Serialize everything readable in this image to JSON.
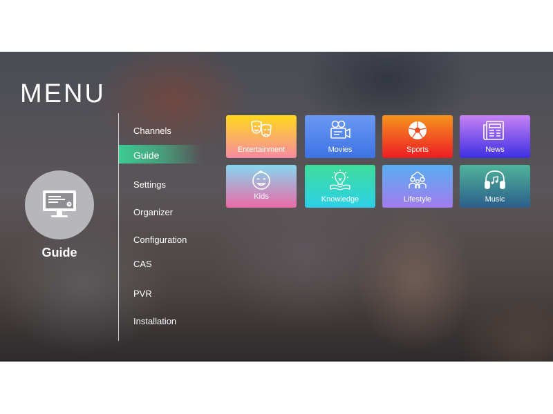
{
  "header": {
    "title": "MENU"
  },
  "current_section": {
    "label": "Guide",
    "icon": "monitor-icon"
  },
  "nav": {
    "active_index": 1,
    "items": [
      {
        "label": "Channels"
      },
      {
        "label": "Guide"
      },
      {
        "label": "Settings"
      },
      {
        "label": "Organizer"
      },
      {
        "label": "Configuration"
      },
      {
        "label": "CAS"
      },
      {
        "label": "PVR"
      },
      {
        "label": "Installation"
      }
    ]
  },
  "tiles": [
    {
      "label": "Entertainment",
      "icon": "theater-masks-icon",
      "colors": [
        "#ffd91c",
        "#f78aa1"
      ]
    },
    {
      "label": "Movies",
      "icon": "movie-camera-icon",
      "colors": [
        "#6a98f2",
        "#3e73e6"
      ]
    },
    {
      "label": "Sports",
      "icon": "soccer-ball-icon",
      "colors": [
        "#f7941d",
        "#ec1c24"
      ]
    },
    {
      "label": "News",
      "icon": "newspaper-icon",
      "colors": [
        "#c682f5",
        "#3d2fe3"
      ]
    },
    {
      "label": "Kids",
      "icon": "baby-face-icon",
      "colors": [
        "#86d7ee",
        "#ea6aa8"
      ]
    },
    {
      "label": "Knowledge",
      "icon": "lightbulb-book-icon",
      "colors": [
        "#3fdd9a",
        "#2cd0e8"
      ]
    },
    {
      "label": "Lifestyle",
      "icon": "family-icon",
      "colors": [
        "#58aef0",
        "#a27bee"
      ]
    },
    {
      "label": "Music",
      "icon": "headphones-icon",
      "colors": [
        "#4fb39a",
        "#2c5e8b"
      ]
    }
  ]
}
